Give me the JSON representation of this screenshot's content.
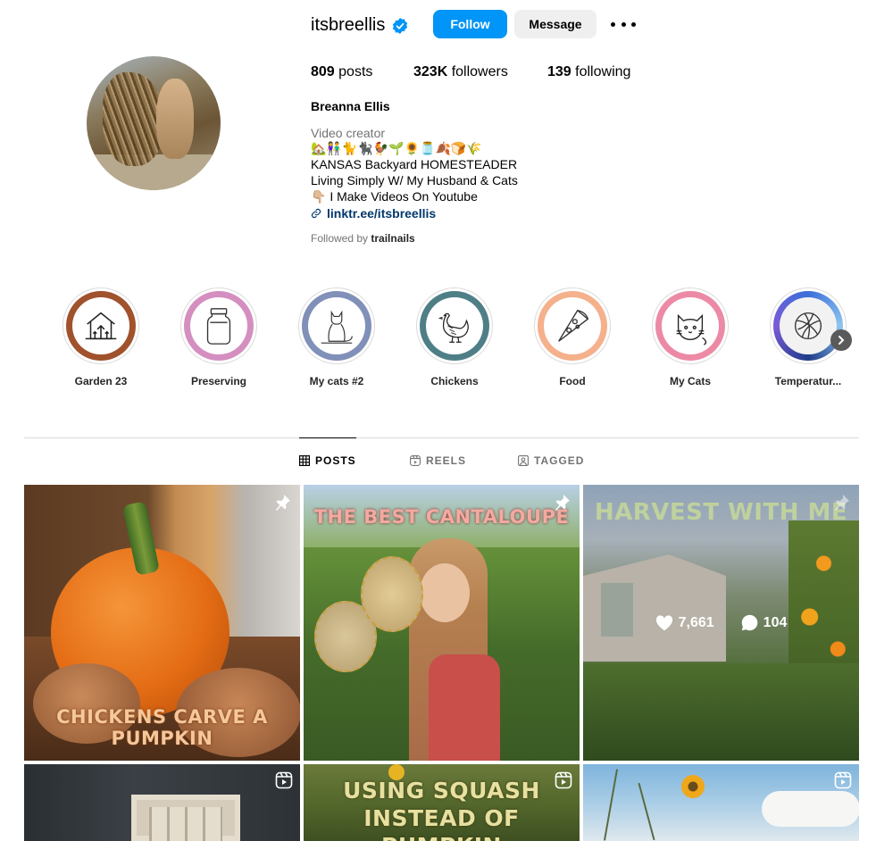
{
  "profile": {
    "username": "itsbreellis",
    "follow_label": "Follow",
    "message_label": "Message",
    "posts_count": "809",
    "posts_label": "posts",
    "followers_count": "323K",
    "followers_label": "followers",
    "following_count": "139",
    "following_label": "following",
    "full_name": "Breanna Ellis",
    "category": "Video creator",
    "bio_emoji": "🏡👫🐈🐈‍⬛🐓🌱🌻🫙🍂🍞🌾",
    "bio_line1": "KANSAS Backyard HOMESTEADER",
    "bio_line2": "Living Simply W/ My Husband & Cats",
    "bio_line3": "👇🏼 I Make Videos On Youtube",
    "link": "linktr.ee/itsbreellis",
    "followed_by_prefix": "Followed by",
    "followed_by_user": "trailnails"
  },
  "highlights": [
    {
      "label": "Garden 23",
      "color": "#a0522d",
      "icon": "garden-house-icon"
    },
    {
      "label": "Preserving",
      "color": "#d48fc0",
      "icon": "mason-jar-icon"
    },
    {
      "label": "My cats #2",
      "color": "#8090b8",
      "icon": "sitting-cat-icon"
    },
    {
      "label": "Chickens",
      "color": "#4f7f86",
      "icon": "chicken-icon"
    },
    {
      "label": "Food",
      "color": "#f5b08c",
      "icon": "pizza-slice-icon"
    },
    {
      "label": "My Cats",
      "color": "#ec8aa6",
      "icon": "cat-face-icon"
    },
    {
      "label": "Temperatur...",
      "color": "#3a6fd8",
      "icon": "yarn-ball-icon"
    }
  ],
  "tabs": [
    {
      "label": "POSTS",
      "active": true
    },
    {
      "label": "REELS",
      "active": false
    },
    {
      "label": "TAGGED",
      "active": false
    }
  ],
  "posts": [
    {
      "caption": "CHICKENS CARVE A PUMPKIN",
      "badge": "pin-icon"
    },
    {
      "caption": "THE BEST CANTALOUPE",
      "badge": "pin-icon"
    },
    {
      "caption": "HARVEST WITH ME",
      "badge": "pin-icon",
      "likes": "7,661",
      "comments": "104"
    },
    {
      "caption": "",
      "badge": "reel-icon"
    },
    {
      "caption_line1": "USING SQUASH",
      "caption_line2": "INSTEAD OF PUMPKIN",
      "badge": "reel-icon"
    },
    {
      "caption": "",
      "badge": "reel-icon"
    }
  ],
  "colors": {
    "follow_button": "#0095f6",
    "link": "#00376b",
    "verified": "#0095f6"
  }
}
